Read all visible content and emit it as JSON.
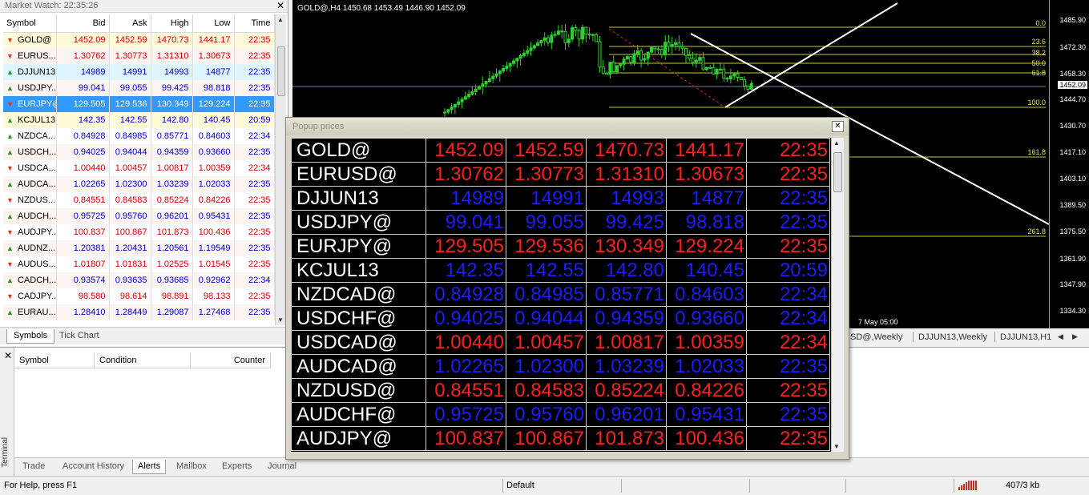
{
  "market_watch": {
    "title": "Market Watch: 22:35:26",
    "columns": [
      "Symbol",
      "Bid",
      "Ask",
      "High",
      "Low",
      "Time"
    ],
    "rows": [
      {
        "dir": "down",
        "symbol": "GOLD@",
        "bid": "1452.09",
        "ask": "1452.59",
        "high": "1470.73",
        "low": "1441.17",
        "time": "22:35",
        "highlight": "yellow"
      },
      {
        "dir": "down",
        "symbol": "EURUS...",
        "bid": "1.30762",
        "ask": "1.30773",
        "high": "1.31310",
        "low": "1.30673",
        "time": "22:35",
        "highlight": ""
      },
      {
        "dir": "up",
        "symbol": "DJJUN13",
        "bid": "14989",
        "ask": "14991",
        "high": "14993",
        "low": "14877",
        "time": "22:35",
        "highlight": "blue"
      },
      {
        "dir": "up",
        "symbol": "USDJPY...",
        "bid": "99.041",
        "ask": "99.055",
        "high": "99.425",
        "low": "98.818",
        "time": "22:35",
        "highlight": ""
      },
      {
        "dir": "down",
        "symbol": "EURJPY@",
        "bid": "129.505",
        "ask": "129.536",
        "high": "130.349",
        "low": "129.224",
        "time": "22:35",
        "highlight": "selected"
      },
      {
        "dir": "up",
        "symbol": "KCJUL13",
        "bid": "142.35",
        "ask": "142.55",
        "high": "142.80",
        "low": "140.45",
        "time": "20:59",
        "highlight": "yellow"
      },
      {
        "dir": "up",
        "symbol": "NZDCA...",
        "bid": "0.84928",
        "ask": "0.84985",
        "high": "0.85771",
        "low": "0.84603",
        "time": "22:34",
        "highlight": ""
      },
      {
        "dir": "up",
        "symbol": "USDCH...",
        "bid": "0.94025",
        "ask": "0.94044",
        "high": "0.94359",
        "low": "0.93660",
        "time": "22:35",
        "highlight": ""
      },
      {
        "dir": "down",
        "symbol": "USDCA...",
        "bid": "1.00440",
        "ask": "1.00457",
        "high": "1.00817",
        "low": "1.00359",
        "time": "22:34",
        "highlight": ""
      },
      {
        "dir": "up",
        "symbol": "AUDCA...",
        "bid": "1.02265",
        "ask": "1.02300",
        "high": "1.03239",
        "low": "1.02033",
        "time": "22:35",
        "highlight": ""
      },
      {
        "dir": "down",
        "symbol": "NZDUS...",
        "bid": "0.84551",
        "ask": "0.84583",
        "high": "0.85224",
        "low": "0.84226",
        "time": "22:35",
        "highlight": ""
      },
      {
        "dir": "up",
        "symbol": "AUDCH...",
        "bid": "0.95725",
        "ask": "0.95760",
        "high": "0.96201",
        "low": "0.95431",
        "time": "22:35",
        "highlight": ""
      },
      {
        "dir": "down",
        "symbol": "AUDJPY...",
        "bid": "100.837",
        "ask": "100.867",
        "high": "101.873",
        "low": "100.436",
        "time": "22:35",
        "highlight": ""
      },
      {
        "dir": "up",
        "symbol": "AUDNZ...",
        "bid": "1.20381",
        "ask": "1.20431",
        "high": "1.20561",
        "low": "1.19549",
        "time": "22:35",
        "highlight": ""
      },
      {
        "dir": "down",
        "symbol": "AUDUS...",
        "bid": "1.01807",
        "ask": "1.01831",
        "high": "1.02525",
        "low": "1.01545",
        "time": "22:35",
        "highlight": ""
      },
      {
        "dir": "up",
        "symbol": "CADCH...",
        "bid": "0.93574",
        "ask": "0.93635",
        "high": "0.93685",
        "low": "0.92962",
        "time": "22:34",
        "highlight": ""
      },
      {
        "dir": "down",
        "symbol": "CADJPY...",
        "bid": "98.580",
        "ask": "98.614",
        "high": "98.891",
        "low": "98.133",
        "time": "22:35",
        "highlight": ""
      },
      {
        "dir": "up",
        "symbol": "EURAU...",
        "bid": "1.28410",
        "ask": "1.28449",
        "high": "1.29087",
        "low": "1.27468",
        "time": "22:35",
        "highlight": ""
      }
    ],
    "tabs": [
      "Symbols",
      "Tick Chart"
    ]
  },
  "chart": {
    "title": "GOLD@,H4  1450.68 1453.49 1446.90 1452.09",
    "price_labels": [
      "1485.90",
      "1472.30",
      "1458.30",
      "1444.70",
      "1430.70",
      "1417.10",
      "1403.10",
      "1389.50",
      "1375.50",
      "1361.90",
      "1347.90",
      "1334.30"
    ],
    "current_price": "1452.09",
    "fib_levels": [
      "0.0",
      "23.6",
      "38.2",
      "50.0",
      "61.8",
      "100.0",
      "161.8",
      "261.8"
    ],
    "time_label": "7 May 05:00",
    "tabs": [
      "SD@,Weekly",
      "DJJUN13,Weekly",
      "DJJUN13,H1"
    ]
  },
  "popup": {
    "title": "Popup prices",
    "rows": [
      {
        "color": "red",
        "symbol": "GOLD@",
        "bid": "1452.09",
        "ask": "1452.59",
        "high": "1470.73",
        "low": "1441.17",
        "time": "22:35"
      },
      {
        "color": "red",
        "symbol": "EURUSD@",
        "bid": "1.30762",
        "ask": "1.30773",
        "high": "1.31310",
        "low": "1.30673",
        "time": "22:35"
      },
      {
        "color": "blue",
        "symbol": "DJJUN13",
        "bid": "14989",
        "ask": "14991",
        "high": "14993",
        "low": "14877",
        "time": "22:35"
      },
      {
        "color": "blue",
        "symbol": "USDJPY@",
        "bid": "99.041",
        "ask": "99.055",
        "high": "99.425",
        "low": "98.818",
        "time": "22:35"
      },
      {
        "color": "red",
        "symbol": "EURJPY@",
        "bid": "129.505",
        "ask": "129.536",
        "high": "130.349",
        "low": "129.224",
        "time": "22:35"
      },
      {
        "color": "blue",
        "symbol": "KCJUL13",
        "bid": "142.35",
        "ask": "142.55",
        "high": "142.80",
        "low": "140.45",
        "time": "20:59"
      },
      {
        "color": "blue",
        "symbol": "NZDCAD@",
        "bid": "0.84928",
        "ask": "0.84985",
        "high": "0.85771",
        "low": "0.84603",
        "time": "22:34"
      },
      {
        "color": "blue",
        "symbol": "USDCHF@",
        "bid": "0.94025",
        "ask": "0.94044",
        "high": "0.94359",
        "low": "0.93660",
        "time": "22:34"
      },
      {
        "color": "red",
        "symbol": "USDCAD@",
        "bid": "1.00440",
        "ask": "1.00457",
        "high": "1.00817",
        "low": "1.00359",
        "time": "22:34"
      },
      {
        "color": "blue",
        "symbol": "AUDCAD@",
        "bid": "1.02265",
        "ask": "1.02300",
        "high": "1.03239",
        "low": "1.02033",
        "time": "22:35"
      },
      {
        "color": "red",
        "symbol": "NZDUSD@",
        "bid": "0.84551",
        "ask": "0.84583",
        "high": "0.85224",
        "low": "0.84226",
        "time": "22:35"
      },
      {
        "color": "blue",
        "symbol": "AUDCHF@",
        "bid": "0.95725",
        "ask": "0.95760",
        "high": "0.96201",
        "low": "0.95431",
        "time": "22:35"
      },
      {
        "color": "red",
        "symbol": "AUDJPY@",
        "bid": "100.837",
        "ask": "100.867",
        "high": "101.873",
        "low": "100.436",
        "time": "22:35"
      }
    ]
  },
  "terminal": {
    "label": "Terminal",
    "alert_columns": [
      "Symbol",
      "Condition",
      "Counter"
    ],
    "tabs": [
      "Trade",
      "Account History",
      "Alerts",
      "Mailbox",
      "Experts",
      "Journal"
    ],
    "active_tab": "Alerts"
  },
  "status": {
    "help": "For Help, press F1",
    "profile": "Default",
    "traffic": "407/3 kb"
  },
  "colors": {
    "bull": "#1a9b1a",
    "bear": "#d04020",
    "up_text": "#0000c8",
    "down_text": "#d00000",
    "fib": "#e6e64a",
    "selected": "#3399ff"
  }
}
